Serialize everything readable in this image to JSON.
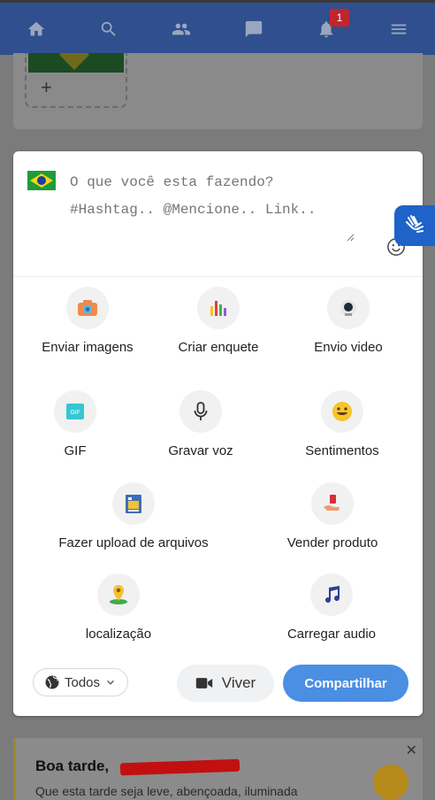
{
  "nav": {
    "notification_count": "1",
    "items": [
      "home-icon",
      "search-icon",
      "friends-icon",
      "messages-icon",
      "notifications-icon",
      "menu-icon"
    ]
  },
  "greeting": {
    "title": "Boa tarde,",
    "subtitle": "Que esta tarde seja leve, abençoada, iluminada"
  },
  "composer": {
    "placeholder": "O que você esta fazendo? #Hashtag.. @Mencione.. Link..",
    "options": [
      {
        "label": "Enviar imagens",
        "icon": "camera-icon"
      },
      {
        "label": "Criar enquete",
        "icon": "poll-icon"
      },
      {
        "label": "Envio video",
        "icon": "video-icon"
      },
      {
        "label": "GIF",
        "icon": "gif-icon"
      },
      {
        "label": "Gravar voz",
        "icon": "microphone-icon"
      },
      {
        "label": "Sentimentos",
        "icon": "smile-icon"
      },
      {
        "label": "Fazer upload de arquivos",
        "icon": "file-icon"
      },
      {
        "label": "Vender produto",
        "icon": "sell-product-icon"
      },
      {
        "label": "localização",
        "icon": "location-icon"
      },
      {
        "label": "Carregar audio",
        "icon": "music-icon"
      }
    ],
    "audience": "Todos",
    "live_label": "Viver",
    "share_label": "Compartilhar"
  },
  "colors": {
    "nav_bg": "#2f4f8e",
    "share_button": "#4a8fe2",
    "badge": "#c0262e"
  }
}
